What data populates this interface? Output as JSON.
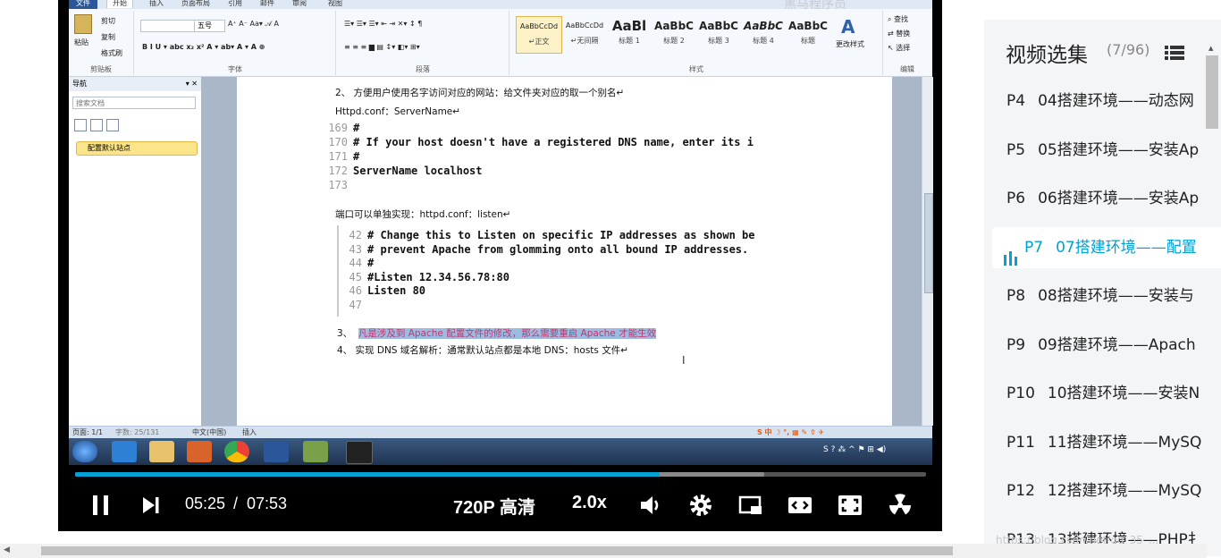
{
  "ribbon": {
    "tabs": [
      "文件",
      "开始",
      "插入",
      "页面布局",
      "引用",
      "邮件",
      "审阅",
      "视图"
    ],
    "clipboard": {
      "paste": "粘贴",
      "cut": "剪切",
      "copy": "复制",
      "format_painter": "格式刷",
      "label": "剪贴板"
    },
    "font": {
      "size": "五号",
      "label": "字体"
    },
    "paragraph": {
      "label": "段落"
    },
    "styles": {
      "items": [
        {
          "sample": "AaBbCcDd",
          "name": "↵正文"
        },
        {
          "sample": "AaBbCcDd",
          "name": "↵无间隔"
        },
        {
          "sample": "AaBl",
          "name": "标题 1"
        },
        {
          "sample": "AaBbC",
          "name": "标题 2"
        },
        {
          "sample": "AaBbC",
          "name": "标题 3"
        },
        {
          "sample": "AaBbC",
          "name": "标题 4"
        },
        {
          "sample": "AaBbC",
          "name": "标题"
        }
      ],
      "change": "更改样式",
      "label": "样式"
    },
    "editing": {
      "find": "查找",
      "replace": "替换",
      "select": "选择",
      "label": "编辑"
    },
    "watermark_text": "黑马程序员"
  },
  "nav": {
    "title": "导航",
    "search_placeholder": "搜索文档",
    "item": "配置默认站点"
  },
  "doc": {
    "line1": "2、 方便用户使用名字访问对应的网站：给文件夹对应的取一个别名↵",
    "httpd_label": "Httpd.conf：ServerName↵",
    "code1": [
      {
        "n": "169",
        "t": "#"
      },
      {
        "n": "170",
        "t": "# If your host doesn't have a registered DNS name, enter its i"
      },
      {
        "n": "171",
        "t": "#"
      },
      {
        "n": "172",
        "t": "ServerName localhost"
      },
      {
        "n": "173",
        "t": ""
      }
    ],
    "port_line": "端口可以单独实现：httpd.conf：listen↵",
    "code2": [
      {
        "n": "42",
        "t": "# Change this to Listen on specific IP addresses as shown be"
      },
      {
        "n": "43",
        "t": "# prevent Apache from glomming onto all bound IP addresses."
      },
      {
        "n": "44",
        "t": "#"
      },
      {
        "n": "45",
        "t": "#Listen 12.34.56.78:80"
      },
      {
        "n": "46",
        "t": "Listen 80"
      },
      {
        "n": "47",
        "t": ""
      }
    ],
    "item3_num": "3、",
    "item3": "凡是涉及到 Apache 配置文件的修改，那么需要重启 Apache 才能生效",
    "item4": "4、 实现 DNS 域名解析：通常默认站点都是本地 DNS：hosts 文件↵"
  },
  "statusbar": {
    "page": "页面: 1/1",
    "words": "字数: 25/131",
    "lang": "中文(中国)",
    "mode": "插入"
  },
  "player": {
    "current_time": "05:25",
    "separator": "/",
    "duration": "07:53",
    "quality": "720P 高清",
    "speed": "2.0x",
    "progress": 0.687,
    "buffered": 0.81
  },
  "sidebar": {
    "title": "视频选集",
    "count": "(7/96)",
    "episodes": [
      {
        "p": "P4",
        "title": "04搭建环境——动态网"
      },
      {
        "p": "P5",
        "title": "05搭建环境——安装Ap"
      },
      {
        "p": "P6",
        "title": "06搭建环境——安装Ap"
      },
      {
        "p": "P7",
        "title": "07搭建环境——配置"
      },
      {
        "p": "P8",
        "title": "08搭建环境——安装与"
      },
      {
        "p": "P9",
        "title": "09搭建环境——Apach"
      },
      {
        "p": "P10",
        "title": "10搭建环境——安装N"
      },
      {
        "p": "P11",
        "title": "11搭建环境——MySQ"
      },
      {
        "p": "P12",
        "title": "12搭建环境——MySQ"
      },
      {
        "p": "P13",
        "title": "13搭建环境——PHP扌"
      }
    ],
    "watermark": "https://blog.csdn.net/qq_35_..."
  },
  "colors": {
    "accent": "#00a1d6",
    "highlight": "#9bbbe3",
    "player_bg": "#000000"
  }
}
